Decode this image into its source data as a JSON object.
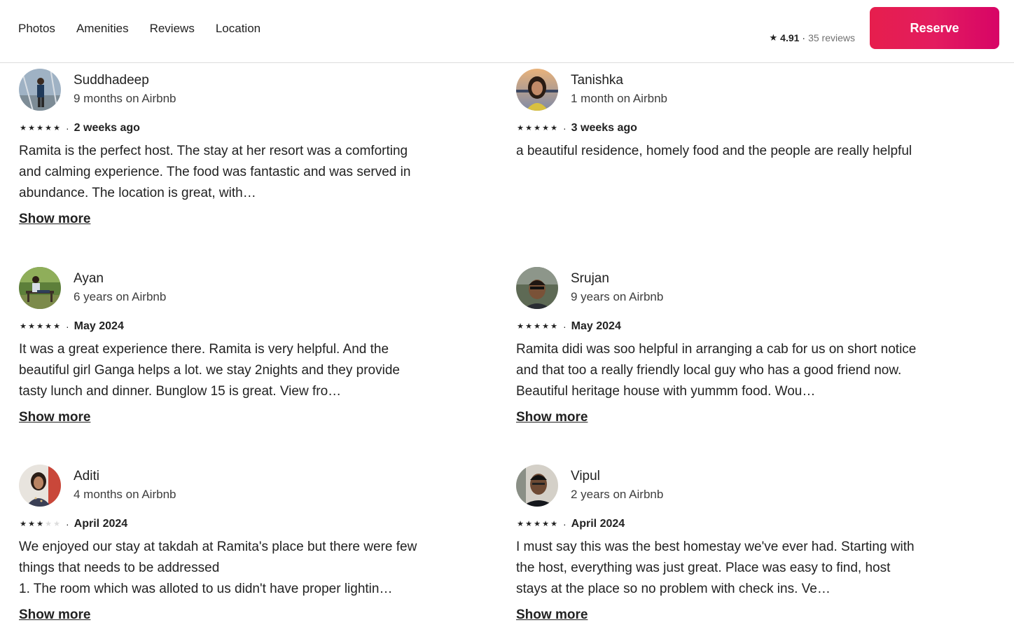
{
  "nav": {
    "photos": "Photos",
    "amenities": "Amenities",
    "reviews": "Reviews",
    "location": "Location"
  },
  "summary": {
    "rating": "4.91",
    "separator": "·",
    "reviews_count": "35 reviews"
  },
  "reserve_label": "Reserve",
  "colors": {
    "brand_start": "#e61e4d",
    "brand_end": "#d70466",
    "text": "#222222",
    "muted": "#717171"
  },
  "reviews": [
    {
      "name": "Suddhadeep",
      "tenure": "9 months on Airbnb",
      "stars": 5,
      "date": "2 weeks ago",
      "text": "Ramita is the perfect host. The stay at her resort was a comforting and calming experience. The food was fantastic and was served in abundance. The location is great, with…",
      "show_more": "Show more",
      "avatar_icon": "person-photo"
    },
    {
      "name": "Tanishka",
      "tenure": "1 month on Airbnb",
      "stars": 5,
      "date": "3 weeks ago",
      "text": "a beautiful residence, homely food and the people are really helpful",
      "show_more": "",
      "avatar_icon": "person-photo"
    },
    {
      "name": "Ayan",
      "tenure": "6 years on Airbnb",
      "stars": 5,
      "date": "May 2024",
      "text": "It was a great experience there. Ramita is very helpful. And the beautiful girl Ganga helps a lot. we stay 2nights and they provide tasty lunch and dinner. Bunglow 15 is great. View fro…",
      "show_more": "Show more",
      "avatar_icon": "person-photo"
    },
    {
      "name": "Srujan",
      "tenure": "9 years on Airbnb",
      "stars": 5,
      "date": "May 2024",
      "text": "Ramita didi was soo helpful in arranging a cab for us on short notice and that too a really friendly local guy who has a good friend now. Beautiful heritage house with yummm food. Wou…",
      "show_more": "Show more",
      "avatar_icon": "person-photo"
    },
    {
      "name": "Aditi",
      "tenure": "4 months on Airbnb",
      "stars": 3,
      "date": "April 2024",
      "text": "We enjoyed our stay at takdah at Ramita's place but there were few things that needs to be addressed\n1. The room which was alloted to us didn't have proper lightin…",
      "show_more": "Show more",
      "avatar_icon": "person-photo"
    },
    {
      "name": "Vipul",
      "tenure": "2 years on Airbnb",
      "stars": 5,
      "date": "April 2024",
      "text": "I must say this was the best homestay we've ever had. Starting with the host, everything was just great. Place was easy to find, host stays at the place so no problem with check ins. Ve…",
      "show_more": "Show more",
      "avatar_icon": "person-photo"
    }
  ]
}
